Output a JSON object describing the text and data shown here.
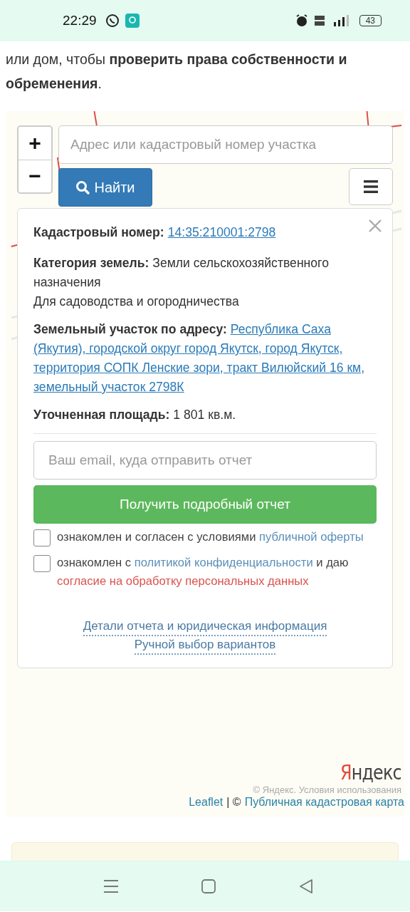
{
  "status_bar": {
    "time": "22:29",
    "battery": "43"
  },
  "intro": {
    "text": "или дом, чтобы **проверить права собственности и обременения**."
  },
  "map": {
    "zoom_in": "+",
    "zoom_out": "−",
    "search": {
      "placeholder": "Адрес или кадастровый номер участка"
    },
    "find_button": "Найти",
    "popup": {
      "cadastral": {
        "label": "Кадастровый номер:",
        "value": "14:35:210001:2798"
      },
      "category": {
        "label": "Категория земель:",
        "value": "Земли сельскохозяйственного назначения",
        "use": "Для садоводства и огородничества"
      },
      "address": {
        "label": "Земельный участок по адресу:",
        "value": "Республика Саха (Якутия), городской округ город Якутск, город Якутск, территория СОПК Ленские зори, тракт Вилюйский 16 км, земельный участок 2798К"
      },
      "area": {
        "label": "Уточненная площадь:",
        "value": "1 801 кв.м."
      },
      "email": {
        "placeholder": "Ваш email, куда отправить отчет"
      },
      "submit_button": "Получить подробный отчет",
      "consents": [
        {
          "checked": false,
          "parts": [
            {
              "kind": "text",
              "text": "ознакомлен и согласен с условиями"
            },
            {
              "kind": "link",
              "text": "публичной оферты"
            }
          ]
        },
        {
          "checked": false,
          "parts": [
            {
              "kind": "text",
              "text": "ознакомлен с"
            },
            {
              "kind": "link",
              "text": "политикой конфиденциальности"
            },
            {
              "kind": "text",
              "text": "и даю"
            },
            {
              "kind": "alert",
              "text": "согласие на обработку персональных данных"
            }
          ]
        }
      ],
      "links": [
        "Детали отчета и юридическая информация",
        "Ручной выбор вариантов"
      ]
    },
    "attribution": {
      "logo_first": "Я",
      "logo_rest": "ндекс",
      "terms": "© Яндекс. Условия использования",
      "leaflet": "Leaflet",
      "separator": "| ©",
      "source": "Публичная кадастровая карта"
    }
  }
}
